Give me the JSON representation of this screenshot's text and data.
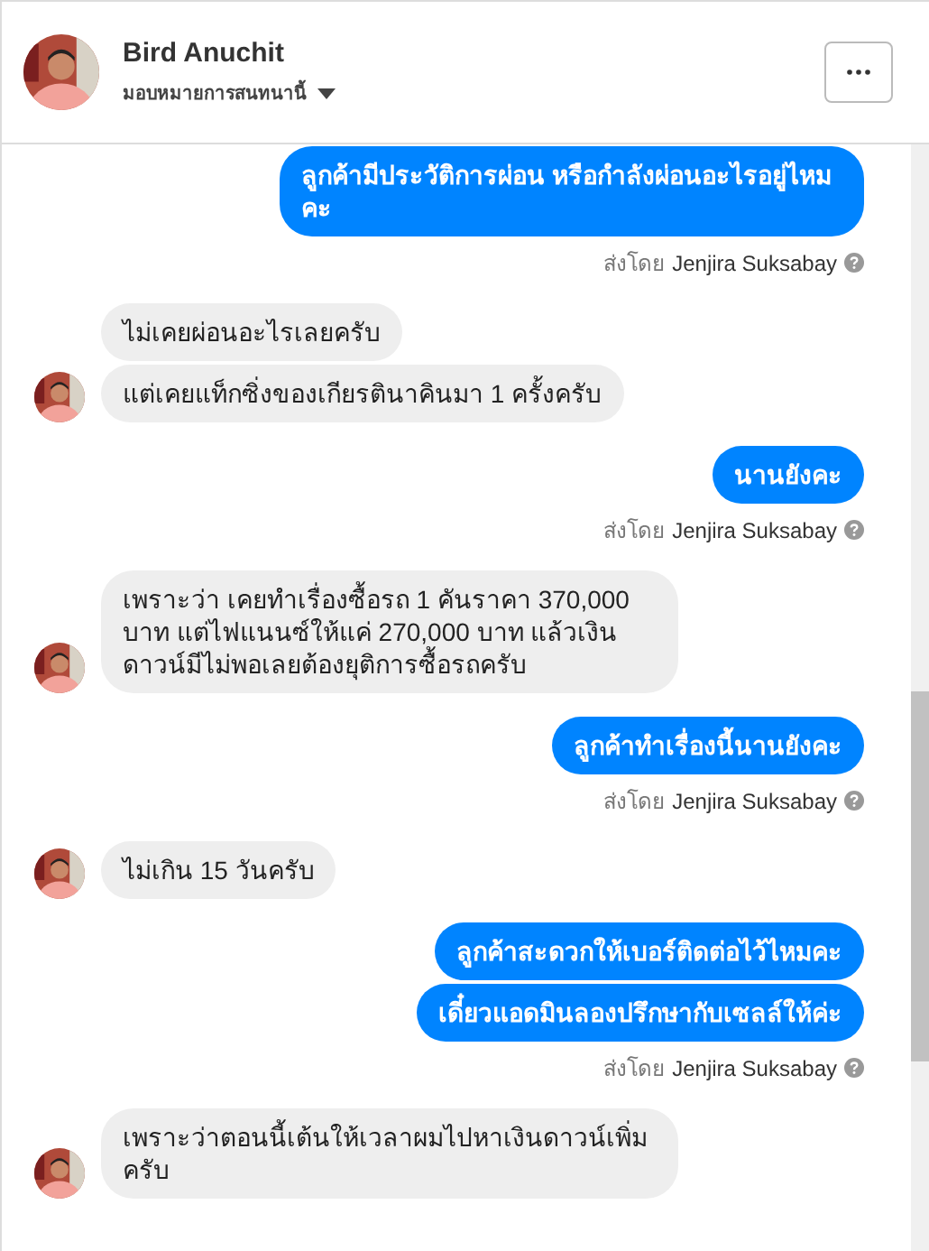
{
  "header": {
    "name": "Bird Anuchit",
    "assign_label": "มอบหมายการสนทนานี้"
  },
  "groups": [
    {
      "kind": "outgoing",
      "messages": [
        "ลูกค้ามีประวัติการผ่อน หรือกำลังผ่อนอะไรอยู่ไหมคะ"
      ],
      "sent_prefix": "ส่งโดย",
      "sent_by": "Jenjira Suksabay"
    },
    {
      "kind": "incoming",
      "messages": [
        "ไม่เคยผ่อนอะไรเลยครับ",
        "แต่เคยแท็กซิ่งของเกียรตินาคินมา 1 ครั้งครับ"
      ]
    },
    {
      "kind": "outgoing",
      "messages": [
        "นานยังคะ"
      ],
      "sent_prefix": "ส่งโดย",
      "sent_by": "Jenjira Suksabay"
    },
    {
      "kind": "incoming",
      "messages": [
        "เพราะว่า เคยทำเรื่องซื้อรถ 1 คันราคา 370,000 บาท แต่ไฟแนนซ์ให้แค่ 270,000 บาท แล้วเงินดาวน์มีไม่พอเลยต้องยุติการซื้อรถครับ"
      ]
    },
    {
      "kind": "outgoing",
      "messages": [
        "ลูกค้าทำเรื่องนี้นานยังคะ"
      ],
      "sent_prefix": "ส่งโดย",
      "sent_by": "Jenjira Suksabay"
    },
    {
      "kind": "incoming",
      "messages": [
        "ไม่เกิน 15 วันครับ"
      ]
    },
    {
      "kind": "outgoing",
      "messages": [
        "ลูกค้าสะดวกให้เบอร์ติดต่อไว้ไหมคะ",
        "เดี๋ยวแอดมินลองปรึกษากับเซลล์ให้ค่ะ"
      ],
      "sent_prefix": "ส่งโดย",
      "sent_by": "Jenjira Suksabay"
    },
    {
      "kind": "incoming",
      "messages": [
        "เพราะว่าตอนนี้เต้นให้เวลาผมไปหาเงินดาวน์เพิ่มครับ"
      ]
    }
  ]
}
